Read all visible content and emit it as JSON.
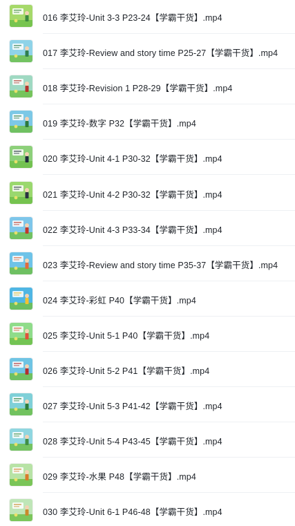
{
  "files": [
    {
      "name": "016 李艾玲-Unit 3-3 P23-24【学霸干货】.mp4",
      "thumb_bg": "#a6d96a",
      "thumb_accent": "#3d8a3f",
      "thumb_icon": "video-thumbnail-icon"
    },
    {
      "name": "017 李艾玲-Review and story time P25-27【学霸干货】.mp4",
      "thumb_bg": "#8fd3e8",
      "thumb_accent": "#2f7f4f",
      "thumb_icon": "video-thumbnail-icon"
    },
    {
      "name": "018 李艾玲-Revision 1 P28-29【学霸干货】.mp4",
      "thumb_bg": "#9fd9c2",
      "thumb_accent": "#b3342c",
      "thumb_icon": "video-thumbnail-icon"
    },
    {
      "name": "019 李艾玲-数字 P32【学霸干货】.mp4",
      "thumb_bg": "#7cc8e6",
      "thumb_accent": "#2d7a3b",
      "thumb_icon": "video-thumbnail-icon"
    },
    {
      "name": "020 李艾玲-Unit 4-1 P30-32【学霸干货】.mp4",
      "thumb_bg": "#8dd07a",
      "thumb_accent": "#1e2b3c",
      "thumb_icon": "video-thumbnail-icon"
    },
    {
      "name": "021 李艾玲-Unit 4-2 P30-32【学霸干货】.mp4",
      "thumb_bg": "#9ad86e",
      "thumb_accent": "#2a3340",
      "thumb_icon": "video-thumbnail-icon"
    },
    {
      "name": "022 李艾玲-Unit 4-3 P33-34【学霸干货】.mp4",
      "thumb_bg": "#7ec6ea",
      "thumb_accent": "#c0392b",
      "thumb_icon": "video-thumbnail-icon"
    },
    {
      "name": "023 李艾玲-Review and story time P35-37【学霸干货】.mp4",
      "thumb_bg": "#6ec3e8",
      "thumb_accent": "#e26b3c",
      "thumb_icon": "video-thumbnail-icon"
    },
    {
      "name": "024 李艾玲-彩虹 P40【学霸干货】.mp4",
      "thumb_bg": "#4fb6e4",
      "thumb_accent": "#f2c230",
      "thumb_icon": "video-thumbnail-icon"
    },
    {
      "name": "025 李艾玲-Unit 5-1 P40【学霸干货】.mp4",
      "thumb_bg": "#8fdc8a",
      "thumb_accent": "#e0523a",
      "thumb_icon": "video-thumbnail-icon"
    },
    {
      "name": "026 李艾玲-Unit 5-2 P41【学霸干货】.mp4",
      "thumb_bg": "#6fc4e4",
      "thumb_accent": "#b32e2e",
      "thumb_icon": "video-thumbnail-icon"
    },
    {
      "name": "027 李艾玲-Unit 5-3 P41-42【学霸干货】.mp4",
      "thumb_bg": "#7fd0d8",
      "thumb_accent": "#2e7d3a",
      "thumb_icon": "video-thumbnail-icon"
    },
    {
      "name": "028 李艾玲-Unit 5-4 P43-45【学霸干货】.mp4",
      "thumb_bg": "#8fd6e0",
      "thumb_accent": "#3f8f46",
      "thumb_icon": "video-thumbnail-icon"
    },
    {
      "name": "029 李艾玲-水果 P48【学霸干货】.mp4",
      "thumb_bg": "#b8e3a6",
      "thumb_accent": "#d97c2b",
      "thumb_icon": "video-thumbnail-icon"
    },
    {
      "name": "030 李艾玲-Unit 6-1 P46-48【学霸干货】.mp4",
      "thumb_bg": "#bfe6b8",
      "thumb_accent": "#c98a2c",
      "thumb_icon": "video-thumbnail-icon"
    }
  ]
}
